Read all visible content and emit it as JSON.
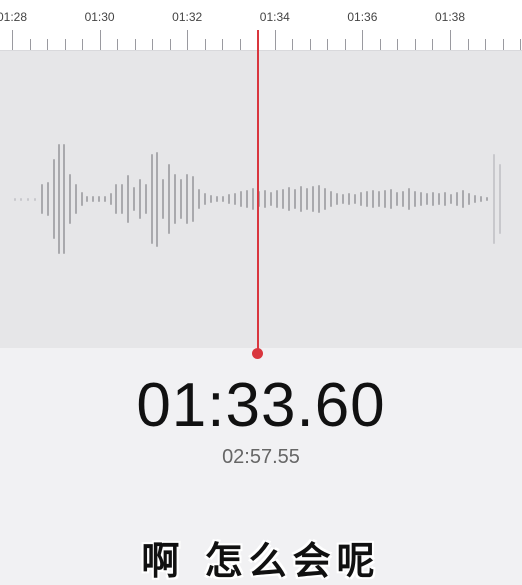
{
  "timeline": {
    "tick_labels": [
      "01:28",
      "01:30",
      "01:32",
      "01:34",
      "01:36",
      "01:38"
    ]
  },
  "player": {
    "current_time": "01:33.60",
    "total_time": "02:57.55"
  },
  "caption": {
    "text": "啊 怎么会呢"
  },
  "colors": {
    "playhead": "#d9363e",
    "waveform": "#a9a9ad",
    "background": "#f1f1f3"
  }
}
